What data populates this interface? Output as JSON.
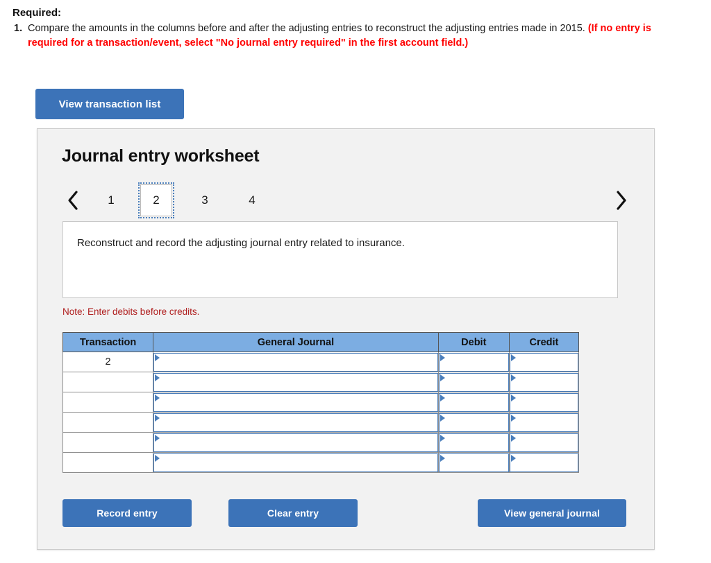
{
  "required": {
    "heading": "Required:",
    "item_number": "1.",
    "text_plain": "Compare the amounts in the columns before and after the adjusting entries to reconstruct the adjusting entries made in 2015. ",
    "text_red": "(If no entry is required for a transaction/event, select \"No journal entry required\" in the first account field.)"
  },
  "toolbar": {
    "view_transaction_list_label": "View transaction list"
  },
  "worksheet": {
    "title": "Journal entry worksheet",
    "prev_arrow": "chevron-left-icon",
    "next_arrow": "chevron-right-icon",
    "tabs": [
      {
        "label": "1",
        "selected": false
      },
      {
        "label": "2",
        "selected": true
      },
      {
        "label": "3",
        "selected": false
      },
      {
        "label": "4",
        "selected": false
      }
    ],
    "instruction": "Reconstruct and record the adjusting journal entry related to insurance.",
    "note": "Note: Enter debits before credits.",
    "table": {
      "headers": [
        "Transaction",
        "General Journal",
        "Debit",
        "Credit"
      ],
      "rows": [
        {
          "transaction": "2",
          "general_journal": "",
          "debit": "",
          "credit": ""
        },
        {
          "transaction": "",
          "general_journal": "",
          "debit": "",
          "credit": ""
        },
        {
          "transaction": "",
          "general_journal": "",
          "debit": "",
          "credit": ""
        },
        {
          "transaction": "",
          "general_journal": "",
          "debit": "",
          "credit": ""
        },
        {
          "transaction": "",
          "general_journal": "",
          "debit": "",
          "credit": ""
        },
        {
          "transaction": "",
          "general_journal": "",
          "debit": "",
          "credit": ""
        }
      ]
    },
    "footer": {
      "record_label": "Record entry",
      "clear_label": "Clear entry",
      "view_journal_label": "View general journal"
    }
  },
  "colors": {
    "button_blue": "#3c73b8",
    "table_header_blue": "#7cade2",
    "field_border_blue": "#4a7ebb",
    "note_red": "#b02020",
    "instruction_red": "#ff0000",
    "card_background": "#f2f2f2"
  }
}
